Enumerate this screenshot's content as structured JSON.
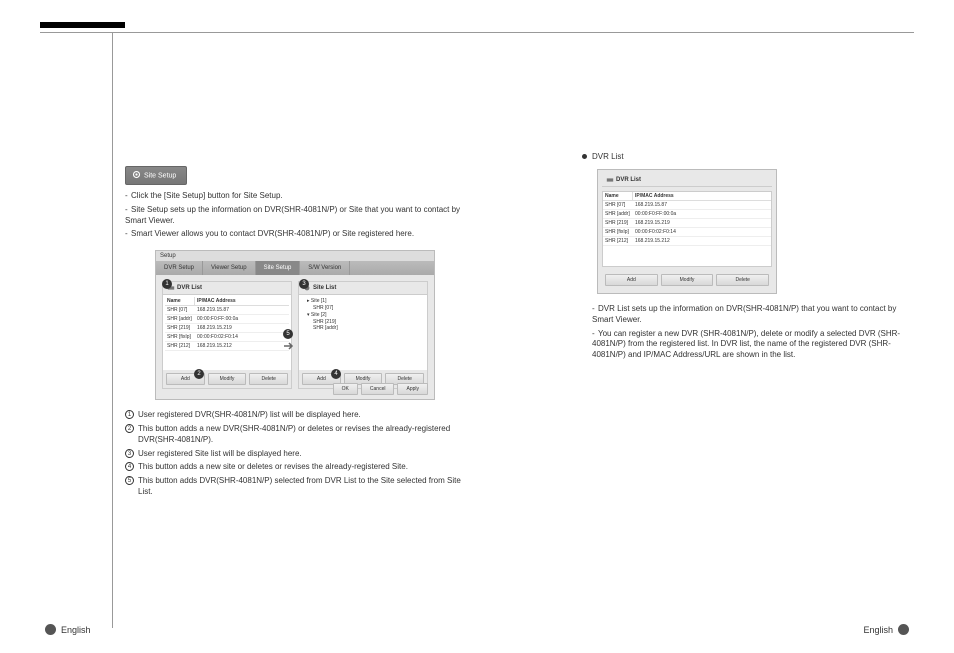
{
  "topbar": {},
  "siteSetupBtn": {
    "label": "Site Setup"
  },
  "leftIntro": [
    "Click the [Site Setup] button for Site Setup.",
    "Site Setup sets up the information on DVR(SHR-4081N/P) or Site that you want to contact by Smart Viewer.",
    "Smart Viewer allows you to contact DVR(SHR-4081N/P) or Site registered here."
  ],
  "screenshot": {
    "tabs": [
      "DVR Setup",
      "Viewer Setup",
      "Site Setup",
      "S/W Version"
    ],
    "activeTab": 2,
    "dvrList": {
      "title": "DVR List",
      "headers": [
        "Name",
        "IP/MAC Address"
      ],
      "rows": [
        [
          "SHR [07]",
          "168.219.15.87"
        ],
        [
          "SHR [addr]",
          "00:00:F0:FF:00:0a"
        ],
        [
          "SHR [219]",
          "168.219.15.219"
        ],
        [
          "SHR [fixIp]",
          "00:00:F0:02:F0:14"
        ],
        [
          "SHR [212]",
          "168.219.15.212"
        ]
      ],
      "buttons": [
        "Add",
        "Modify",
        "Delete"
      ]
    },
    "siteList": {
      "title": "Site List",
      "items": [
        {
          "label": "Site [1]",
          "children": [
            "SHR [07]"
          ]
        },
        {
          "label": "Site [2]",
          "children": [
            "SHR [219]",
            "SHR [addr]"
          ]
        }
      ],
      "buttons": [
        "Add",
        "Modify",
        "Delete"
      ]
    },
    "bottomButtons": [
      "OK",
      "Cancel",
      "Apply"
    ]
  },
  "numbered": [
    "User registered DVR(SHR-4081N/P) list will be displayed here.",
    "This button adds a new DVR(SHR-4081N/P) or deletes or revises the already-registered DVR(SHR-4081N/P).",
    "User registered Site list will be displayed here.",
    "This button adds a new site or deletes or revises the already-registered Site.",
    "This button adds DVR(SHR-4081N/P) selected from DVR List to the Site selected from Site List."
  ],
  "right": {
    "heading": "DVR List",
    "dvrList": {
      "title": "DVR List",
      "headers": [
        "Name",
        "IP/MAC Address"
      ],
      "rows": [
        [
          "SHR [07]",
          "168.219.15.87"
        ],
        [
          "SHR [addr]",
          "00:00:F0:FF:00:0a"
        ],
        [
          "SHR [219]",
          "168.219.15.219"
        ],
        [
          "SHR [fixIp]",
          "00:00:F0:02:F0:14"
        ],
        [
          "SHR [212]",
          "168.219.15.212"
        ]
      ],
      "buttons": [
        "Add",
        "Modify",
        "Delete"
      ]
    },
    "paras": [
      "DVR List sets up the information on DVR(SHR-4081N/P) that you want to contact by Smart Viewer.",
      "You can register a new DVR (SHR-4081N/P), delete or modify a selected DVR (SHR-4081N/P) from the registered list. In DVR list, the name of the registered DVR (SHR-4081N/P) and IP/MAC Address/URL are shown in the list."
    ]
  },
  "footer": {
    "label": "English"
  }
}
